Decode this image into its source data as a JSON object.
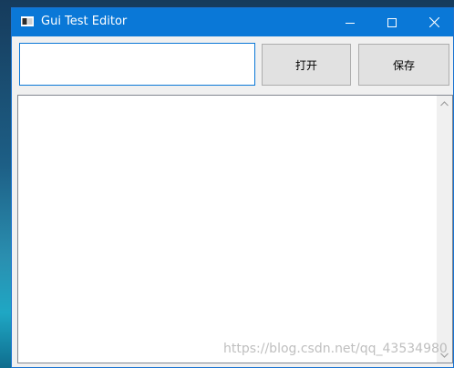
{
  "window": {
    "title": "Gui Test Editor",
    "icon": "window-app-icon",
    "controls": {
      "minimize_icon": "minimize-icon",
      "maximize_icon": "maximize-icon",
      "close_icon": "close-icon"
    }
  },
  "toolbar": {
    "path_input_value": "",
    "open_label": "打开",
    "save_label": "保存"
  },
  "editor": {
    "content": ""
  },
  "watermark": "https://blog.csdn.net/qq_43534980",
  "colors": {
    "titlebar": "#0a78d7",
    "window_bg": "#f0f0f0",
    "button_bg": "#e1e1e1",
    "input_border": "#0a78d7"
  }
}
